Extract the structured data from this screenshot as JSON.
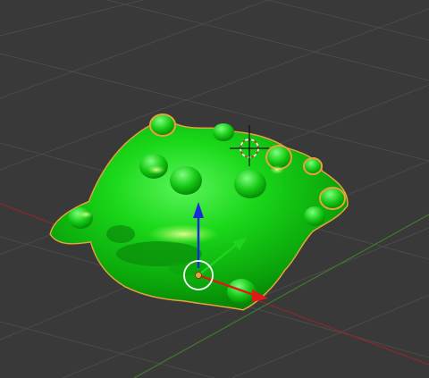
{
  "viewport": {
    "background": "#393939",
    "grid_color": "#4a4a4a",
    "x_axis_color": "#8a2a2a",
    "y_axis_color": "#3f7a2a"
  },
  "object": {
    "kind": "sculpted-blob-mesh",
    "selected": true,
    "material_color": "#12d612",
    "outline_color": "#e8a23a"
  },
  "gizmo": {
    "x_arrow_color": "#e01818",
    "y_arrow_color": "#1ed41e",
    "z_arrow_color": "#1a2bd8",
    "pivot_color": "#e8a23a",
    "ring_color": "#ffffff"
  },
  "cursor_3d": {
    "icon": "3d-cursor-icon"
  }
}
